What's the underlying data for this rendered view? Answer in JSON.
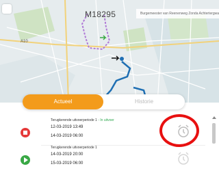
{
  "map": {
    "vehicle_code": "M18295",
    "banner_text": "Burgemeester van Reenenweg Zonda Achtertergwarten",
    "road_label": "A10",
    "colors": {
      "route_purple": "#b07ad6",
      "route_blue": "#1f6fb3",
      "water": "#c9d7dd"
    }
  },
  "tabs": {
    "active_label": "Actueel",
    "inactive_label": "Historie",
    "accent_color": "#f39b1b"
  },
  "rows": [
    {
      "title": "Terugkerende uitvoerperiode 1",
      "status": " - In uitvoer",
      "start": "12-03-2019 13:49",
      "end": "14-03-2019 06:00",
      "state_icon": "stop-icon",
      "action_icon": "alarm-clock-icon"
    },
    {
      "title": "Terugkerende uitvoerperiode 1",
      "status": "",
      "start": "14-03-2019 20:00",
      "end": "15-03-2019 06:00",
      "state_icon": "play-icon",
      "action_icon": "alarm-clock-icon"
    }
  ]
}
